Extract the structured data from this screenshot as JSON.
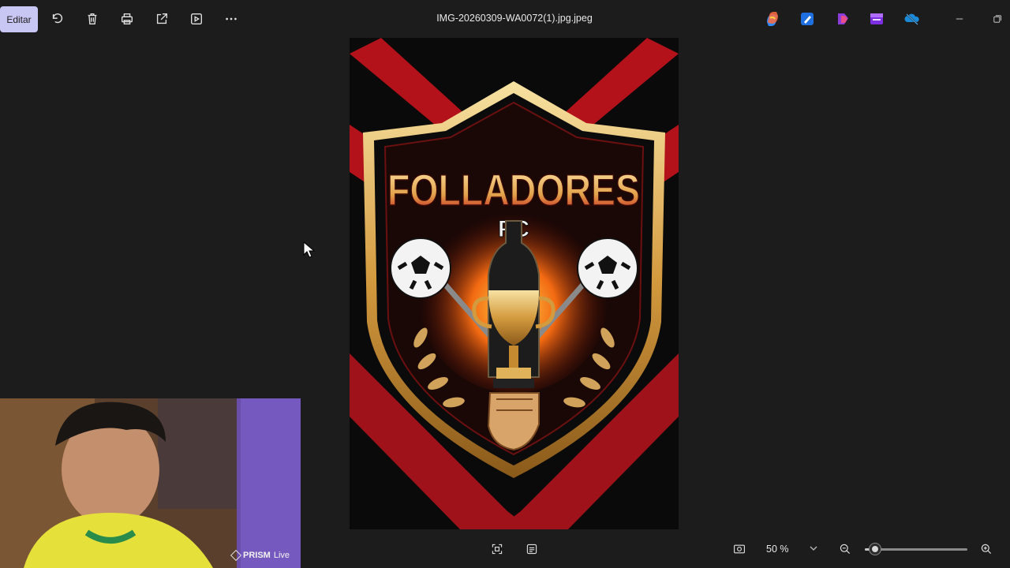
{
  "toolbar": {
    "edit_label": "Editar",
    "icons": [
      "rotate-icon",
      "delete-icon",
      "print-icon",
      "share-icon",
      "slideshow-icon",
      "more-icon"
    ]
  },
  "file": {
    "title": "IMG-20260309-WA0072(1).jpg.jpeg"
  },
  "apps": [
    "copilot-icon",
    "designer-icon",
    "clipchamp-icon",
    "photos-icon",
    "onedrive-icon"
  ],
  "image": {
    "crest_title": "FOLLADORES",
    "crest_subtitle": "FC"
  },
  "webcam": {
    "badge_brand": "PRISM",
    "badge_suffix": "Live"
  },
  "bottombar": {
    "zoom_value": "50 %",
    "zoom_fraction": 0.1
  },
  "colors": {
    "accent_edit": "#c8c6f3",
    "background": "#1c1c1c",
    "crest_red": "#c0161c",
    "crest_gold": "#e3b665"
  }
}
